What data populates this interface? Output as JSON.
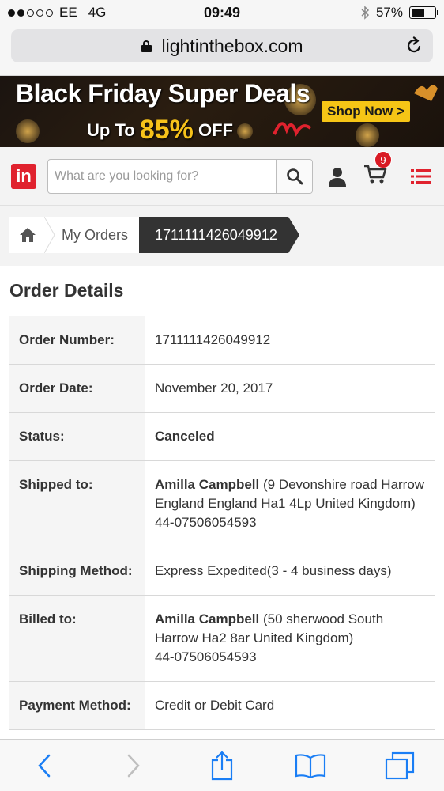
{
  "status_bar": {
    "carrier": "EE",
    "network": "4G",
    "time": "09:49",
    "battery_percent": "57%",
    "battery_level": 0.57,
    "signal_bars_filled": 2,
    "signal_bars_total": 5
  },
  "browser": {
    "url": "lightinthebox.com"
  },
  "banner": {
    "title": "Black Friday Super Deals",
    "sub_prefix": "Up To",
    "sub_percent": "85%",
    "sub_suffix": "OFF",
    "cta": "Shop Now >"
  },
  "header": {
    "logo_text": "in",
    "search_placeholder": "What are you looking for?",
    "cart_count": "9"
  },
  "breadcrumb": {
    "items": [
      "My Orders",
      "1711111426049912"
    ]
  },
  "order": {
    "section_title": "Order Details",
    "rows": [
      {
        "label": "Order Number:",
        "value": "1711111426049912"
      },
      {
        "label": "Order Date:",
        "value": "November 20, 2017"
      },
      {
        "label": "Status:",
        "value": "Canceled"
      },
      {
        "label": "Shipped to:",
        "name": "Amilla Campbell",
        "address": " (9 Devonshire road Harrow England England Ha1 4Lp United Kingdom)",
        "phone": "44-07506054593"
      },
      {
        "label": "Shipping Method:",
        "value": "Express Expedited(3 - 4 business days)"
      },
      {
        "label": "Billed to:",
        "name": "Amilla Campbell",
        "address": " (50 sherwood South Harrow Ha2 8ar United Kingdom)",
        "phone": "44-07506054593"
      },
      {
        "label": "Payment Method:",
        "value": "Credit or Debit Card"
      }
    ]
  },
  "colors": {
    "brand_red": "#e0222e",
    "badge_red": "#d91a24",
    "breadcrumb_active": "#333333",
    "ios_blue": "#1a7ef5",
    "banner_yellow": "#f6c516"
  }
}
